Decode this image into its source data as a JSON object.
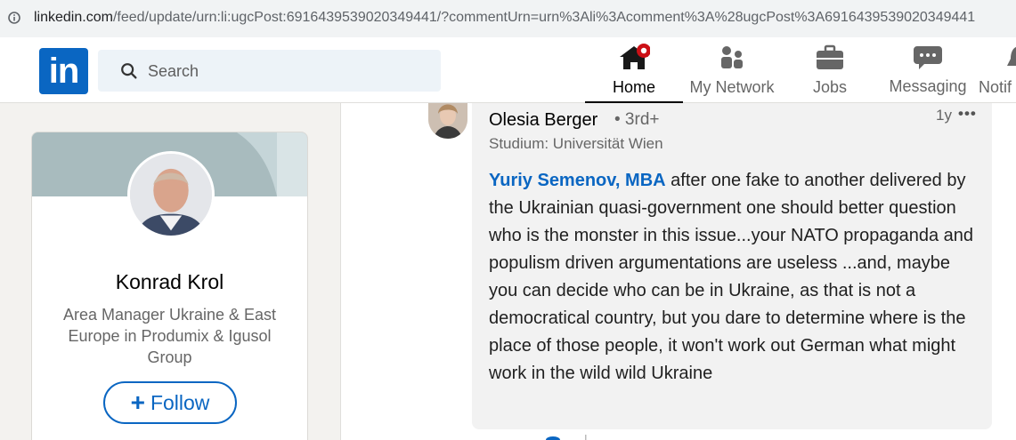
{
  "browser": {
    "url_host": "linkedin.com",
    "url_path": "/feed/update/urn:li:ugcPost:6916439539020349441/?commentUrn=urn%3Ali%3Acomment%3A%28ugcPost%3A6916439539020349441"
  },
  "header": {
    "logo_text": "in",
    "search_placeholder": "Search",
    "nav": [
      {
        "label": "Home",
        "icon": "home-icon",
        "active": true,
        "badge": true
      },
      {
        "label": "My Network",
        "icon": "network-icon"
      },
      {
        "label": "Jobs",
        "icon": "briefcase-icon"
      },
      {
        "label": "Messaging",
        "icon": "messaging-icon"
      },
      {
        "label": "Notif",
        "icon": "bell-icon"
      }
    ]
  },
  "profile": {
    "name": "Konrad Krol",
    "headline": "Area Manager Ukraine & East Europe in Produmix & Igusol Group",
    "follow_plus": "+",
    "follow_label": "Follow"
  },
  "comment": {
    "author": "Olesia Berger",
    "degree": "• 3rd+",
    "author_headline": "Studium: Universität Wien",
    "time": "1y",
    "more": "•••",
    "mention": "Yuriy Semenov, MBA",
    "text": " after one fake to another delivered by the Ukrainian quasi-government one should better question who is the monster in this issue...your NATO propaganda and populism driven argumentations are useless ...and, maybe you can decide who can be in Ukraine, as that is not a democratical country, but you dare to determine where is the place of those people, it won't work out German what might work in the wild wild Ukraine"
  },
  "colors": {
    "brand": "#0a66c2",
    "notification": "#cc1016"
  }
}
